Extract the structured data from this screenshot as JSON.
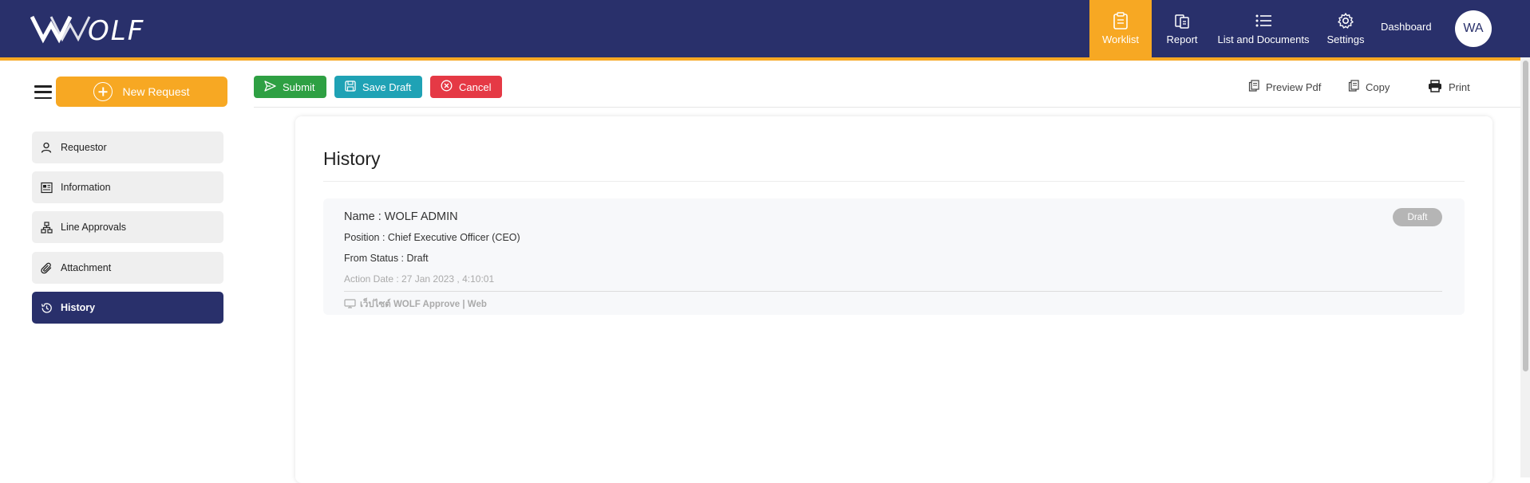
{
  "header": {
    "logo_text": "OLF",
    "nav": {
      "worklist": "Worklist",
      "report": "Report",
      "list_documents": "List and Documents",
      "settings": "Settings",
      "dashboard": "Dashboard"
    },
    "avatar_initials": "WA",
    "accent_color": "#f7a823",
    "brand_color": "#29306b"
  },
  "sidebar": {
    "new_request": "New Request",
    "items": [
      {
        "label": "Requestor",
        "icon": "person-icon"
      },
      {
        "label": "Information",
        "icon": "newspaper-icon"
      },
      {
        "label": "Line Approvals",
        "icon": "org-chart-icon"
      },
      {
        "label": "Attachment",
        "icon": "paperclip-icon"
      },
      {
        "label": "History",
        "icon": "history-icon",
        "active": true
      }
    ]
  },
  "toolbar": {
    "submit": "Submit",
    "save_draft": "Save Draft",
    "cancel": "Cancel",
    "preview_pdf": "Preview Pdf",
    "copy": "Copy",
    "print": "Print"
  },
  "main": {
    "title": "History",
    "entries": [
      {
        "name": "Name : WOLF ADMIN",
        "position": "Position : Chief Executive Officer (CEO)",
        "from_status": "From Status : Draft",
        "action_date": "Action Date : 27 Jan 2023 , 4:10:01",
        "source": "เว็ปไซต์ WOLF Approve | Web",
        "badge": "Draft"
      }
    ]
  }
}
